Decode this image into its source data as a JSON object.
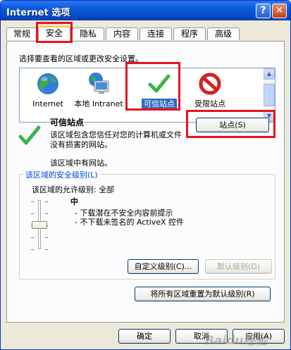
{
  "window": {
    "title": "Internet 选项",
    "help": "?",
    "close": "✕"
  },
  "tabs": [
    {
      "label": "常规"
    },
    {
      "label": "安全"
    },
    {
      "label": "隐私"
    },
    {
      "label": "内容"
    },
    {
      "label": "连接"
    },
    {
      "label": "程序"
    },
    {
      "label": "高级"
    }
  ],
  "zones_prompt": "选择要查看的区域或更改安全设置。",
  "zones": [
    {
      "label": "Internet",
      "icon": "globe-icon"
    },
    {
      "label": "本地 Intranet",
      "icon": "monitor-icon"
    },
    {
      "label": "可信站点",
      "icon": "checkmark-icon"
    },
    {
      "label": "受限站点",
      "icon": "prohibited-icon"
    }
  ],
  "selected_zone": {
    "title": "可信站点",
    "description": "该区域包含您信任对您的计算机或文件没有损害的网站。",
    "note": "该区域中有网站。",
    "sites_button": "站点(S)"
  },
  "security_level": {
    "group_title": "该区域的安全级别(L)",
    "allowed_label": "该区域的允许级别: 全部",
    "level": "中",
    "bullets": [
      "- 下载潜在不安全内容前提示",
      "- 不下载未签名的 ActiveX 控件"
    ],
    "custom_button": "自定义级别(C)...",
    "default_button": "默认级别(D)",
    "reset_button": "将所有区域重置为默认级别(R)"
  },
  "footer": {
    "ok": "确定",
    "cancel": "取消",
    "apply": "应用(A)"
  },
  "watermark": "Baidu经验",
  "colors": {
    "title_bar": "#0a5bd8",
    "highlight": "#316ac5",
    "annotation": "#e8141d",
    "check_green": "#3cb44b"
  }
}
